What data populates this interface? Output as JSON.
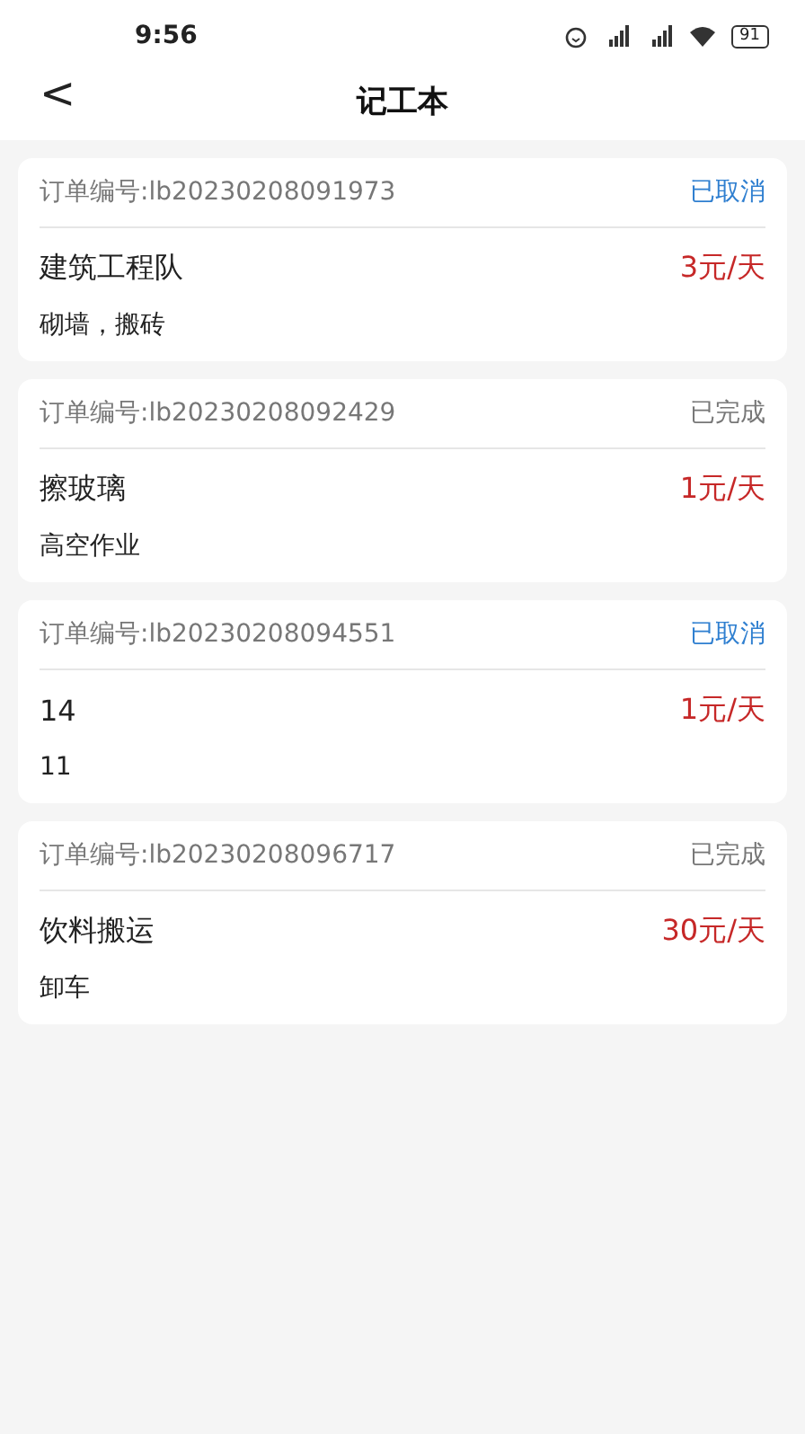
{
  "status_bar": {
    "time": "9:56",
    "battery": "91"
  },
  "header": {
    "back": "<",
    "title": "记工本"
  },
  "orders": [
    {
      "number": "订单编号:lb20230208091973",
      "status": "已取消",
      "kind": "cancelled",
      "name": "建筑工程队",
      "price": "3元/天",
      "description": "砌墙，搬砖"
    },
    {
      "number": "订单编号:lb20230208092429",
      "status": "已完成",
      "kind": "completed",
      "name": "擦玻璃",
      "price": "1元/天",
      "description": "高空作业"
    },
    {
      "number": "订单编号:lb20230208094551",
      "status": "已取消",
      "kind": "cancelled",
      "name": "14",
      "price": "1元/天",
      "description": "11"
    },
    {
      "number": "订单编号:lb20230208096717",
      "status": "已完成",
      "kind": "completed",
      "name": "饮料搬运",
      "price": "30元/天",
      "description": "卸车"
    }
  ]
}
